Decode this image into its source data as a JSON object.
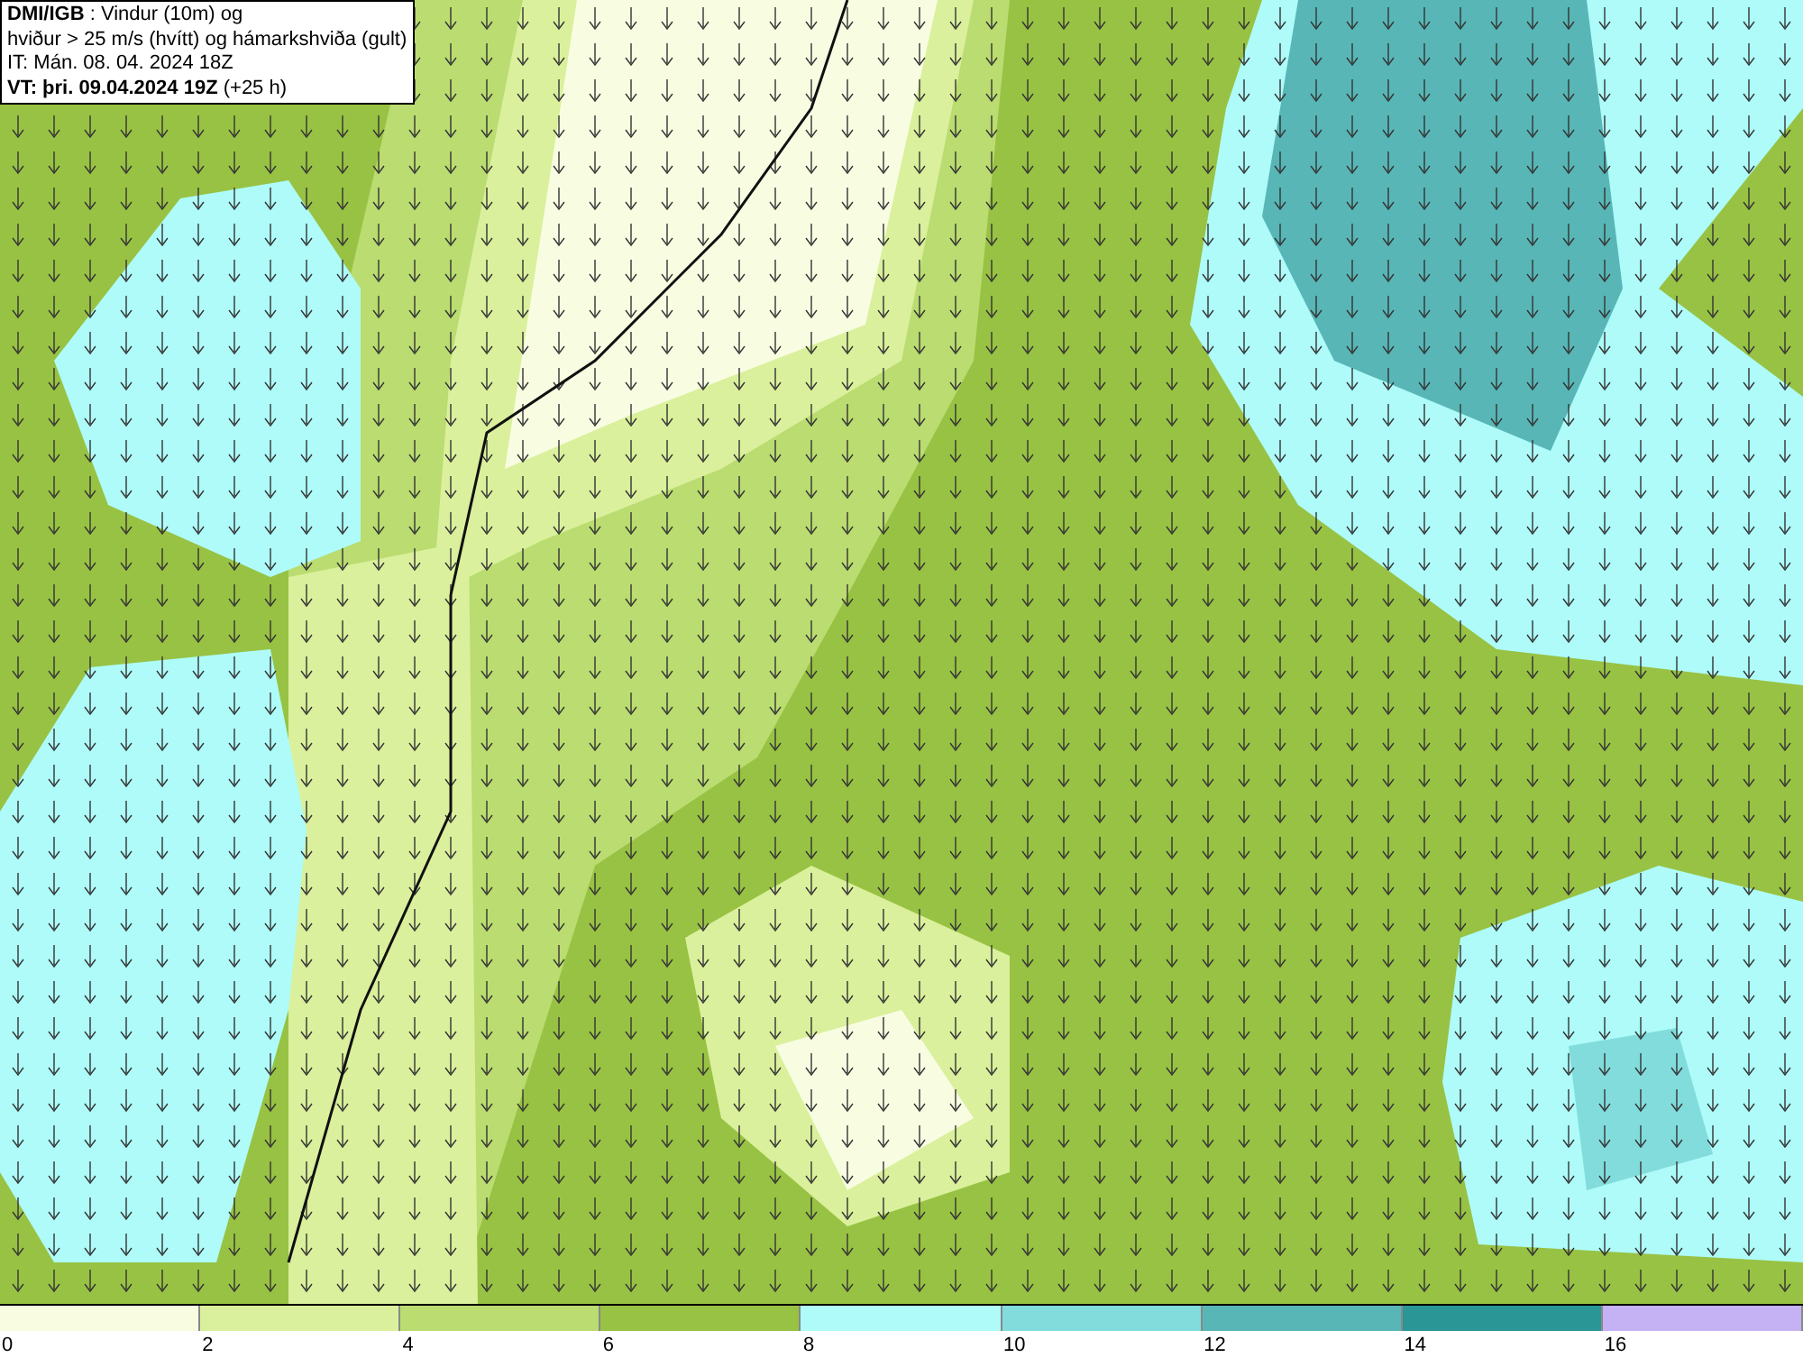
{
  "info_box": {
    "lines": [
      "**DMI/IGB** : Vindur (10m) og",
      "hviður > 25 m/s (hvítt) og hámarkshviða (gult)",
      "IT: Mán. 08. 04. 2024 18Z",
      "**VT: þri. 09.04.2024 19Z** (+25 h)"
    ]
  },
  "legend": [
    {
      "label": "0",
      "color": "#f8fde2"
    },
    {
      "label": "2",
      "color": "#daf09c"
    },
    {
      "label": "4",
      "color": "#badc70"
    },
    {
      "label": "6",
      "color": "#98c243"
    },
    {
      "label": "8",
      "color": "#aefbf9"
    },
    {
      "label": "10",
      "color": "#82dcdc"
    },
    {
      "label": "12",
      "color": "#58b6b6"
    },
    {
      "label": "14",
      "color": "#2b9696"
    },
    {
      "label": "16",
      "color": "#c4b2f4"
    }
  ]
}
